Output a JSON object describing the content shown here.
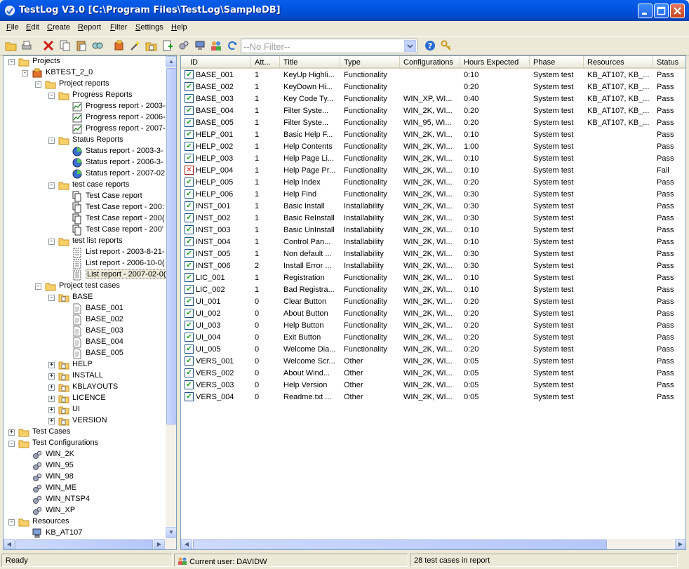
{
  "window": {
    "title": "TestLog V3.0 [C:\\Program Files\\TestLog\\SampleDB]"
  },
  "menu": [
    "File",
    "Edit",
    "Create",
    "Report",
    "Filter",
    "Settings",
    "Help"
  ],
  "toolbar": {
    "filter_value": "--No Filter--"
  },
  "tree": {
    "nodes": [
      {
        "label": "Projects",
        "icon": "folder-icon",
        "expander": "-",
        "level": 0
      },
      {
        "label": "KBTEST_2_0",
        "icon": "project-icon",
        "expander": "-",
        "level": 1
      },
      {
        "label": "Project reports",
        "icon": "folder-icon",
        "expander": "-",
        "level": 2
      },
      {
        "label": "Progress Reports",
        "icon": "folder-icon",
        "expander": "-",
        "level": 3
      },
      {
        "label": "Progress report - 2003-",
        "icon": "chart-report-icon",
        "expander": "",
        "level": 4
      },
      {
        "label": "Progress report - 2006-",
        "icon": "chart-report-icon",
        "expander": "",
        "level": 4
      },
      {
        "label": "Progress report - 2007-",
        "icon": "chart-report-icon",
        "expander": "",
        "level": 4
      },
      {
        "label": "Status Reports",
        "icon": "folder-icon",
        "expander": "-",
        "level": 3
      },
      {
        "label": "Status report - 2003-3-",
        "icon": "pie-report-icon",
        "expander": "",
        "level": 4
      },
      {
        "label": "Status report - 2006-3-",
        "icon": "pie-report-icon",
        "expander": "",
        "level": 4
      },
      {
        "label": "Status report - 2007-02",
        "icon": "pie-report-icon",
        "expander": "",
        "level": 4
      },
      {
        "label": "test case reports",
        "icon": "folder-icon",
        "expander": "-",
        "level": 3
      },
      {
        "label": "Test Case report",
        "icon": "pages-report-icon",
        "expander": "",
        "level": 4
      },
      {
        "label": "Test Case report - 200:",
        "icon": "pages-report-icon",
        "expander": "",
        "level": 4
      },
      {
        "label": "Test Case report - 200(",
        "icon": "pages-report-icon",
        "expander": "",
        "level": 4
      },
      {
        "label": "Test Case report - 200'",
        "icon": "pages-report-icon",
        "expander": "",
        "level": 4
      },
      {
        "label": "test list reports",
        "icon": "folder-icon",
        "expander": "-",
        "level": 3
      },
      {
        "label": "List report - 2003-8-21-",
        "icon": "list-report-icon",
        "expander": "",
        "level": 4
      },
      {
        "label": "List report - 2006-10-0(",
        "icon": "list-report-icon",
        "expander": "",
        "level": 4
      },
      {
        "label": "List report - 2007-02-0(",
        "icon": "list-report-icon",
        "expander": "",
        "level": 4,
        "selected": true
      },
      {
        "label": "Project test cases",
        "icon": "folder-icon",
        "expander": "-",
        "level": 2
      },
      {
        "label": "BASE",
        "icon": "test-folder-icon",
        "expander": "-",
        "level": 3
      },
      {
        "label": "BASE_001",
        "icon": "document-icon",
        "expander": "",
        "level": 4
      },
      {
        "label": "BASE_002",
        "icon": "document-icon",
        "expander": "",
        "level": 4
      },
      {
        "label": "BASE_003",
        "icon": "document-icon",
        "expander": "",
        "level": 4
      },
      {
        "label": "BASE_004",
        "icon": "document-icon",
        "expander": "",
        "level": 4
      },
      {
        "label": "BASE_005",
        "icon": "document-icon",
        "expander": "",
        "level": 4
      },
      {
        "label": "HELP",
        "icon": "test-folder-icon",
        "expander": "+",
        "level": 3
      },
      {
        "label": "INSTALL",
        "icon": "test-folder-icon",
        "expander": "+",
        "level": 3
      },
      {
        "label": "KBLAYOUTS",
        "icon": "test-folder-icon",
        "expander": "+",
        "level": 3
      },
      {
        "label": "LICENCE",
        "icon": "test-folder-icon",
        "expander": "+",
        "level": 3
      },
      {
        "label": "UI",
        "icon": "test-folder-icon",
        "expander": "+",
        "level": 3
      },
      {
        "label": "VERSION",
        "icon": "test-folder-icon",
        "expander": "+",
        "level": 3
      },
      {
        "label": "Test Cases",
        "icon": "folder-icon",
        "expander": "+",
        "level": 0
      },
      {
        "label": "Test Configurations",
        "icon": "folder-icon",
        "expander": "-",
        "level": 0
      },
      {
        "label": "WIN_2K",
        "icon": "config-icon",
        "expander": "",
        "level": 1
      },
      {
        "label": "WIN_95",
        "icon": "config-icon",
        "expander": "",
        "level": 1
      },
      {
        "label": "WIN_98",
        "icon": "config-icon",
        "expander": "",
        "level": 1
      },
      {
        "label": "WIN_ME",
        "icon": "config-icon",
        "expander": "",
        "level": 1
      },
      {
        "label": "WIN_NTSP4",
        "icon": "config-icon",
        "expander": "",
        "level": 1
      },
      {
        "label": "WIN_XP",
        "icon": "config-icon",
        "expander": "",
        "level": 1
      },
      {
        "label": "Resources",
        "icon": "folder-icon",
        "expander": "-",
        "level": 0
      },
      {
        "label": "KB_AT107",
        "icon": "computer-icon",
        "expander": "",
        "level": 1
      }
    ]
  },
  "grid": {
    "columns": [
      "ID",
      "Att...",
      "Title",
      "Type",
      "Configurations",
      "Hours Expected",
      "Phase",
      "Resources",
      "Status"
    ],
    "rows": [
      {
        "status_icon": "pass",
        "cells": [
          "BASE_001",
          "1",
          "KeyUp Highli...",
          "Functionality",
          "",
          "0:10",
          "System test",
          "KB_AT107, KB_...",
          "Pass"
        ]
      },
      {
        "status_icon": "pass",
        "cells": [
          "BASE_002",
          "1",
          "KeyDown Hi...",
          "Functionality",
          "",
          "0:20",
          "System test",
          "KB_AT107, KB_...",
          "Pass"
        ]
      },
      {
        "status_icon": "pass",
        "cells": [
          "BASE_003",
          "1",
          "Key Code Ty...",
          "Functionality",
          "WIN_XP, WI...",
          "0:40",
          "System test",
          "KB_AT107, KB_...",
          "Pass"
        ]
      },
      {
        "status_icon": "pass",
        "cells": [
          "BASE_004",
          "1",
          "Filter Syste...",
          "Functionality",
          "WIN_2K, WI...",
          "0:20",
          "System test",
          "KB_AT107, KB_...",
          "Pass"
        ]
      },
      {
        "status_icon": "pass",
        "cells": [
          "BASE_005",
          "1",
          "Filter Syste...",
          "Functionality",
          "WIN_95, WI...",
          "0:20",
          "System test",
          "KB_AT107, KB_...",
          "Pass"
        ]
      },
      {
        "status_icon": "pass",
        "cells": [
          "HELP_001",
          "1",
          "Basic Help F...",
          "Functionality",
          "WIN_2K, WI...",
          "0:10",
          "System test",
          "",
          "Pass"
        ]
      },
      {
        "status_icon": "pass",
        "cells": [
          "HELP_002",
          "1",
          "Help Contents",
          "Functionality",
          "WIN_2K, WI...",
          "1:00",
          "System test",
          "",
          "Pass"
        ]
      },
      {
        "status_icon": "pass",
        "cells": [
          "HELP_003",
          "1",
          "Help Page Li...",
          "Functionality",
          "WIN_2K, WI...",
          "0:10",
          "System test",
          "",
          "Pass"
        ]
      },
      {
        "status_icon": "fail",
        "cells": [
          "HELP_004",
          "1",
          "Help Page Pr...",
          "Functionality",
          "WIN_2K, WI...",
          "0:10",
          "System test",
          "",
          "Fail"
        ]
      },
      {
        "status_icon": "pass",
        "cells": [
          "HELP_005",
          "1",
          "Help Index",
          "Functionality",
          "WIN_2K, WI...",
          "0:20",
          "System test",
          "",
          "Pass"
        ]
      },
      {
        "status_icon": "pass",
        "cells": [
          "HELP_006",
          "1",
          "Help Find",
          "Functionality",
          "WIN_2K, WI...",
          "0:30",
          "System test",
          "",
          "Pass"
        ]
      },
      {
        "status_icon": "pass",
        "cells": [
          "INST_001",
          "1",
          "Basic Install",
          "Installability",
          "WIN_2K, WI...",
          "0:30",
          "System test",
          "",
          "Pass"
        ]
      },
      {
        "status_icon": "pass",
        "cells": [
          "INST_002",
          "1",
          "Basic ReInstall",
          "Installability",
          "WIN_2K, WI...",
          "0:30",
          "System test",
          "",
          "Pass"
        ]
      },
      {
        "status_icon": "pass",
        "cells": [
          "INST_003",
          "1",
          "Basic UnInstall",
          "Installability",
          "WIN_2K, WI...",
          "0:10",
          "System test",
          "",
          "Pass"
        ]
      },
      {
        "status_icon": "pass",
        "cells": [
          "INST_004",
          "1",
          "Control Pan...",
          "Installability",
          "WIN_2K, WI...",
          "0:10",
          "System test",
          "",
          "Pass"
        ]
      },
      {
        "status_icon": "pass",
        "cells": [
          "INST_005",
          "1",
          "Non default ...",
          "Installability",
          "WIN_2K, WI...",
          "0:30",
          "System test",
          "",
          "Pass"
        ]
      },
      {
        "status_icon": "pass",
        "cells": [
          "INST_006",
          "2",
          "Install Error ...",
          "Installability",
          "WIN_2K, WI...",
          "0:30",
          "System test",
          "",
          "Pass"
        ]
      },
      {
        "status_icon": "pass",
        "cells": [
          "LIC_001",
          "1",
          "Registration",
          "Functionality",
          "WIN_2K, WI...",
          "0:10",
          "System test",
          "",
          "Pass"
        ]
      },
      {
        "status_icon": "pass",
        "cells": [
          "LIC_002",
          "1",
          "Bad Registra...",
          "Functionality",
          "WIN_2K, WI...",
          "0:10",
          "System test",
          "",
          "Pass"
        ]
      },
      {
        "status_icon": "pass",
        "cells": [
          "UI_001",
          "0",
          "Clear Button",
          "Functionality",
          "WIN_2K, WI...",
          "0:20",
          "System test",
          "",
          "Pass"
        ]
      },
      {
        "status_icon": "pass",
        "cells": [
          "UI_002",
          "0",
          "About Button",
          "Functionality",
          "WIN_2K, WI...",
          "0:20",
          "System test",
          "",
          "Pass"
        ]
      },
      {
        "status_icon": "pass",
        "cells": [
          "UI_003",
          "0",
          "Help Button",
          "Functionality",
          "WIN_2K, WI...",
          "0:20",
          "System test",
          "",
          "Pass"
        ]
      },
      {
        "status_icon": "pass",
        "cells": [
          "UI_004",
          "0",
          "Exit Button",
          "Functionality",
          "WIN_2K, WI...",
          "0:20",
          "System test",
          "",
          "Pass"
        ]
      },
      {
        "status_icon": "pass",
        "cells": [
          "UI_005",
          "0",
          "Welcome Dia...",
          "Functionality",
          "WIN_2K, WI...",
          "0:20",
          "System test",
          "",
          "Pass"
        ]
      },
      {
        "status_icon": "pass",
        "cells": [
          "VERS_001",
          "0",
          "Welcome Scr...",
          "Other",
          "WIN_2K, WI...",
          "0:05",
          "System test",
          "",
          "Pass"
        ]
      },
      {
        "status_icon": "pass",
        "cells": [
          "VERS_002",
          "0",
          "About Wind...",
          "Other",
          "WIN_2K, WI...",
          "0:05",
          "System test",
          "",
          "Pass"
        ]
      },
      {
        "status_icon": "pass",
        "cells": [
          "VERS_003",
          "0",
          "Help Version",
          "Other",
          "WIN_2K, WI...",
          "0:05",
          "System test",
          "",
          "Pass"
        ]
      },
      {
        "status_icon": "pass",
        "cells": [
          "VERS_004",
          "0",
          "Readme.txt ...",
          "Other",
          "WIN_2K, WI...",
          "0:05",
          "System test",
          "",
          "Pass"
        ]
      }
    ]
  },
  "statusbar": {
    "ready": "Ready",
    "user": "Current user: DAVIDW",
    "count": "28 test cases in report"
  },
  "colors": {
    "titlebar": "#0054e3",
    "pass": "#21a121",
    "fail": "#e01818",
    "folder": "#f3b93a"
  }
}
